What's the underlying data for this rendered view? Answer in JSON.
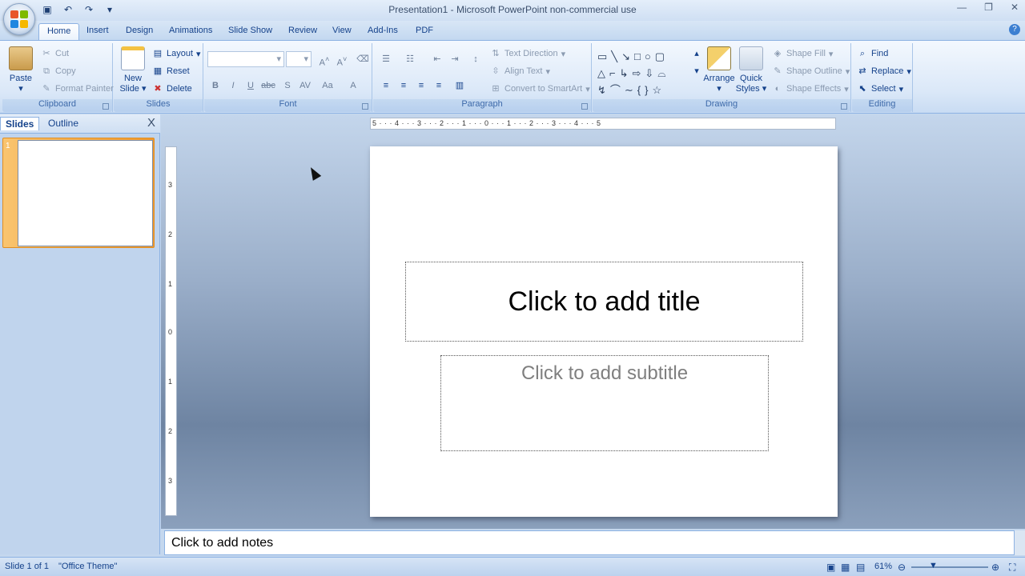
{
  "window": {
    "title": "Presentation1 - Microsoft PowerPoint non-commercial use"
  },
  "quick_access": [
    "save-icon",
    "undo-icon",
    "redo-icon",
    "customize-icon"
  ],
  "ribbon_tabs": [
    "Home",
    "Insert",
    "Design",
    "Animations",
    "Slide Show",
    "Review",
    "View",
    "Add-Ins",
    "PDF"
  ],
  "active_tab": "Home",
  "clipboard": {
    "label": "Clipboard",
    "paste": "Paste",
    "cut": "Cut",
    "copy": "Copy",
    "format_painter": "Format Painter"
  },
  "slides_group": {
    "label": "Slides",
    "new_slide_1": "New",
    "new_slide_2": "Slide",
    "layout": "Layout",
    "reset": "Reset",
    "delete": "Delete"
  },
  "font": {
    "label": "Font",
    "font_name": "",
    "font_size": ""
  },
  "paragraph": {
    "label": "Paragraph",
    "text_direction": "Text Direction",
    "align_text": "Align Text",
    "convert_smartart": "Convert to SmartArt"
  },
  "drawing": {
    "label": "Drawing",
    "arrange": "Arrange",
    "quick_1": "Quick",
    "quick_2": "Styles",
    "shape_fill": "Shape Fill",
    "shape_outline": "Shape Outline",
    "shape_effects": "Shape Effects"
  },
  "editing": {
    "label": "Editing",
    "find": "Find",
    "replace": "Replace",
    "select": "Select"
  },
  "panel": {
    "tab_slides": "Slides",
    "tab_outline": "Outline",
    "close": "X",
    "thumb_number": "1"
  },
  "hruler_text": "5 · · · 4 · · · 3 · · · 2 · · · 1 · · · 0 · · · 1 · · · 2 · · · 3 · · · 4 · · · 5",
  "vruler_labels": [
    "3",
    "2",
    "1",
    "0",
    "1",
    "2",
    "3"
  ],
  "slide": {
    "title_placeholder": "Click to add title",
    "subtitle_placeholder": "Click to add subtitle"
  },
  "notes": {
    "placeholder": "Click to add notes"
  },
  "status": {
    "slide_info": "Slide 1 of 1",
    "theme": "\"Office Theme\"",
    "zoom": "61%"
  }
}
